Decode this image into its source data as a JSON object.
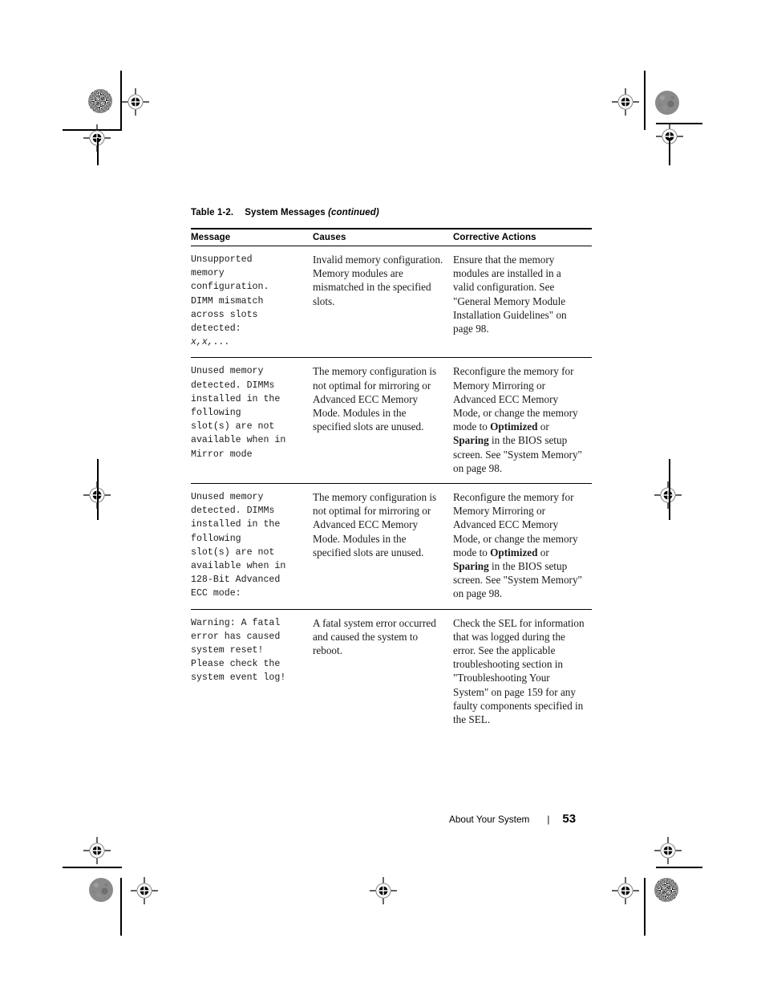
{
  "document": {
    "caption": {
      "number": "Table 1-2.",
      "title": "System Messages",
      "continued": "(continued)"
    },
    "table": {
      "headers": [
        "Message",
        "Causes",
        "Corrective Actions"
      ],
      "rows": [
        {
          "message": "Unsupported memory configuration. DIMM mismatch across slots detected:\nx,x,...",
          "message_code": "Unsupported\nmemory\nconfiguration.\nDIMM mismatch\nacross slots\ndetected:\n",
          "message_italic": "x,x,...",
          "cause": "Invalid memory configuration. Memory modules are mismatched in the specified slots.",
          "action_pre": "Ensure that the memory modules are installed in a valid configuration. See \"General Memory Module Installation Guidelines\" on page 98.",
          "action_bold1": "",
          "action_mid": "",
          "action_bold2": "",
          "action_post": ""
        },
        {
          "message": "Unused memory detected. DIMMs installed in the following slot(s) are not available when in Mirror mode",
          "message_code": "Unused memory\ndetected. DIMMs\ninstalled in the\nfollowing\nslot(s) are not\navailable when in\nMirror mode",
          "message_italic": "",
          "cause": "The memory configuration is not optimal for mirroring or Advanced ECC Memory Mode. Modules in the specified slots are unused.",
          "action_pre": "Reconfigure the memory for Memory Mirroring or Advanced ECC Memory Mode, or change the memory mode to ",
          "action_bold1": "Optimized",
          "action_mid": " or ",
          "action_bold2": "Sparing",
          "action_post": " in the BIOS setup screen. See \"System Memory\" on page 98."
        },
        {
          "message": "Unused memory detected. DIMMs installed in the following slot(s) are not available when in 128-Bit Advanced ECC mode:",
          "message_code": "Unused memory\ndetected. DIMMs\ninstalled in the\nfollowing\nslot(s) are not\navailable when in\n128-Bit Advanced\nECC mode:",
          "message_italic": "",
          "cause": "The memory configuration is not optimal for mirroring or Advanced ECC Memory Mode. Modules in the specified slots are unused.",
          "action_pre": "Reconfigure the memory for Memory Mirroring or Advanced ECC Memory Mode, or change the memory mode to ",
          "action_bold1": "Optimized",
          "action_mid": " or ",
          "action_bold2": "Sparing",
          "action_post": " in the BIOS setup screen. See \"System Memory\" on page 98."
        },
        {
          "message": "Warning: A fatal error has caused system reset! Please check the system event log!",
          "message_code": "Warning: A fatal\nerror has caused\nsystem reset!\nPlease check the\nsystem event log!",
          "message_italic": "",
          "cause": "A fatal system error occurred and caused the system to reboot.",
          "action_pre": "Check the SEL for information that was logged during the error. See the applicable troubleshooting section in \"Troubleshooting Your System\" on page 159 for any faulty components specified in the SEL.",
          "action_bold1": "",
          "action_mid": "",
          "action_bold2": "",
          "action_post": ""
        }
      ]
    },
    "footer": {
      "section": "About Your System",
      "separator": "|",
      "page_number": "53"
    }
  }
}
